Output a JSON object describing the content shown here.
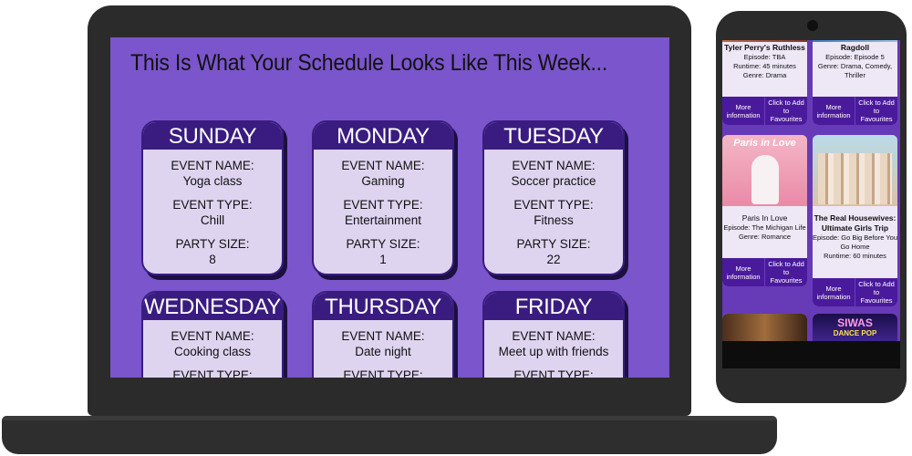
{
  "schedule": {
    "title": "This Is What Your Schedule Looks Like This Week...",
    "field_labels": {
      "name": "EVENT NAME:",
      "type": "EVENT TYPE:",
      "party": "PARTY SIZE:"
    },
    "days": [
      {
        "day": "SUNDAY",
        "name": "Yoga class",
        "type": "Chill",
        "party": "8"
      },
      {
        "day": "MONDAY",
        "name": "Gaming",
        "type": "Entertainment",
        "party": "1"
      },
      {
        "day": "TUESDAY",
        "name": "Soccer practice",
        "type": "Fitness",
        "party": "22"
      },
      {
        "day": "WEDNESDAY",
        "name": "Cooking class",
        "type": "",
        "party": ""
      },
      {
        "day": "THURSDAY",
        "name": "Date night",
        "type": "",
        "party": ""
      },
      {
        "day": "FRIDAY",
        "name": "Meet up with friends",
        "type": "",
        "party": ""
      }
    ]
  },
  "shows": {
    "more_info_label": "More information",
    "favourite_label": "Click to Add to Favourites",
    "items": [
      {
        "title": "Tyler Perry's Ruthless",
        "episode": "Episode: TBA",
        "runtime": "Runtime: 45 minutes",
        "genre": "Genre: Drama"
      },
      {
        "title": "Ragdoll",
        "episode": "Episode: Episode 5",
        "genre": "Genre: Drama, Comedy, Thriller"
      },
      {
        "title": "Paris In Love",
        "poster_text": "Paris in Love",
        "episode": "Episode: The Michigan Life",
        "genre": "Genre: Romance"
      },
      {
        "title": "The Real Housewives: Ultimate Girls Trip",
        "episode": "Episode: Go Big Before You Go Home",
        "runtime": "Runtime: 60 minutes"
      },
      {
        "title": ""
      },
      {
        "title": "SIWAS",
        "poster_text": "SIWAS",
        "poster_subtext": "DANCE POP"
      }
    ]
  },
  "colors": {
    "screen_bg": "#7b55cc",
    "card_header": "#3a1c80",
    "card_body": "#ded4f0",
    "phone_bg": "#673ab7",
    "button": "#4a1a9c"
  }
}
